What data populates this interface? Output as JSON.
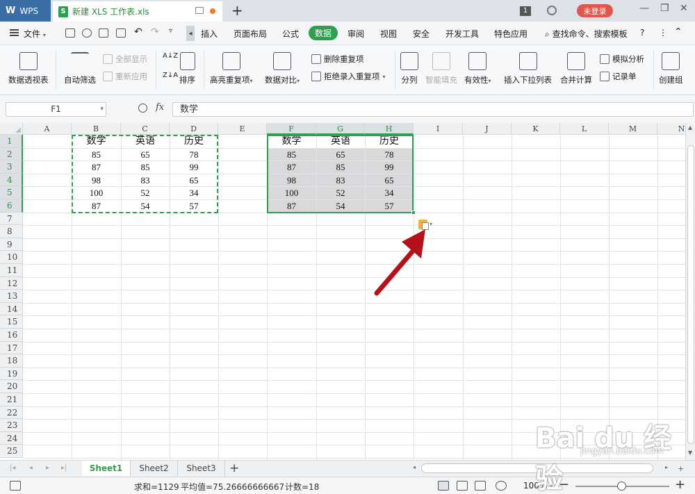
{
  "titlebar": {
    "app_name": "WPS",
    "doc_title": "新建 XLS 工作表.xls",
    "login_label": "未登录",
    "badge": "1"
  },
  "menubar": {
    "file_label": "文件",
    "items": [
      "插入",
      "页面布局",
      "公式",
      "数据",
      "审阅",
      "视图",
      "安全",
      "开发工具",
      "特色应用"
    ],
    "active": "数据",
    "search_label": "查找命令、搜索模板",
    "help": "?"
  },
  "ribbon": {
    "pivot": "数据透视表",
    "autofilter": "自动筛选",
    "show_all": "全部显示",
    "reapply": "重新应用",
    "sort": "排序",
    "highlight_dup": "高亮重复项",
    "compare": "数据对比",
    "remove_dup": "删除重复项",
    "reject_dup": "拒绝录入重复项",
    "split": "分列",
    "smart_fill": "智能填充",
    "validity": "有效性",
    "insert_dropdown": "插入下拉列表",
    "consolidate": "合并计算",
    "simulate": "模拟分析",
    "record": "记录单",
    "group": "创建组"
  },
  "formula": {
    "namebox": "F1",
    "fx": "fx",
    "value": "数学"
  },
  "grid": {
    "columns": [
      "A",
      "B",
      "C",
      "D",
      "E",
      "F",
      "G",
      "H",
      "I",
      "J",
      "K",
      "L",
      "M",
      "N"
    ],
    "rows": [
      "1",
      "2",
      "3",
      "4",
      "5",
      "6",
      "7",
      "8",
      "9",
      "10",
      "11",
      "12",
      "13",
      "14",
      "15",
      "16",
      "17",
      "18",
      "19",
      "20",
      "21",
      "22",
      "23",
      "24",
      "25"
    ],
    "source": {
      "header": [
        "数学",
        "英语",
        "历史"
      ],
      "rows": [
        [
          "85",
          "65",
          "78"
        ],
        [
          "87",
          "85",
          "99"
        ],
        [
          "98",
          "83",
          "65"
        ],
        [
          "100",
          "52",
          "34"
        ],
        [
          "87",
          "54",
          "57"
        ]
      ]
    },
    "pasted": {
      "header": [
        "数学",
        "英语",
        "历史"
      ],
      "rows": [
        [
          "85",
          "65",
          "78"
        ],
        [
          "87",
          "85",
          "99"
        ],
        [
          "98",
          "83",
          "65"
        ],
        [
          "100",
          "52",
          "34"
        ],
        [
          "87",
          "54",
          "57"
        ]
      ]
    }
  },
  "sheets": {
    "tabs": [
      "Sheet1",
      "Sheet2",
      "Sheet3"
    ],
    "active": "Sheet1",
    "add": "+"
  },
  "status": {
    "sum": "求和=1129",
    "avg": "平均值=75.26666666667",
    "count": "计数=18",
    "zoom": "100%"
  },
  "watermark": {
    "logo": "Bai du 经验",
    "url": "jingyan.baidu.com"
  },
  "colors": {
    "accent": "#2e9e4f",
    "title_bar": "#dde2e8",
    "login": "#e0584d",
    "arrow": "#b3121a"
  }
}
